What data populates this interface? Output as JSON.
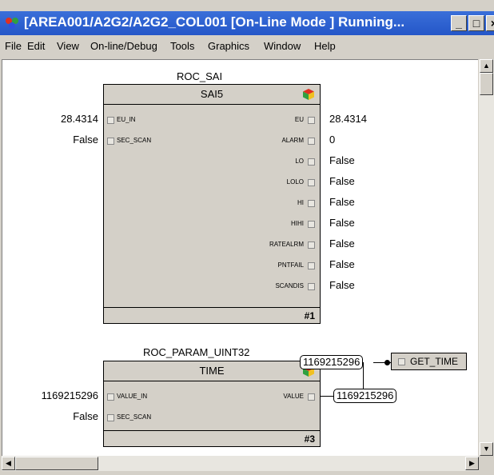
{
  "window": {
    "title": "[AREA001/A2G2/A2G2_COL001 [On-Line Mode ] Running...",
    "minimize_glyph": "_",
    "maximize_glyph": "□",
    "close_glyph": "×"
  },
  "menu": [
    "File",
    "Edit",
    "View",
    "On-line/Debug",
    "Tools",
    "Graphics",
    "Window",
    "Help"
  ],
  "block1": {
    "instance_name": "ROC_SAI",
    "type_name": "SAI5",
    "number": "#1",
    "inputs": [
      {
        "pin": "EU_IN",
        "value": "28.4314"
      },
      {
        "pin": "SEC_SCAN",
        "value": "False"
      }
    ],
    "outputs": [
      {
        "pin": "EU",
        "value": "28.4314"
      },
      {
        "pin": "ALARM",
        "value": "0"
      },
      {
        "pin": "LO",
        "value": "False"
      },
      {
        "pin": "LOLO",
        "value": "False"
      },
      {
        "pin": "HI",
        "value": "False"
      },
      {
        "pin": "HIHI",
        "value": "False"
      },
      {
        "pin": "RATEALRM",
        "value": "False"
      },
      {
        "pin": "PNTFAIL",
        "value": "False"
      },
      {
        "pin": "SCANDIS",
        "value": "False"
      }
    ]
  },
  "block3": {
    "instance_name": "ROC_PARAM_UINT32",
    "type_name": "TIME",
    "number": "#3",
    "inputs": [
      {
        "pin": "VALUE_IN",
        "value": "1169215296"
      },
      {
        "pin": "SEC_SCAN",
        "value": "False"
      }
    ],
    "outputs": [
      {
        "pin": "VALUE"
      }
    ],
    "wire_value_top": "1169215296",
    "wire_value_right": "1169215296",
    "connector_label": "GET_TIME"
  },
  "scroll": {
    "up": "▲",
    "down": "▼",
    "left": "◀",
    "right": "▶"
  }
}
